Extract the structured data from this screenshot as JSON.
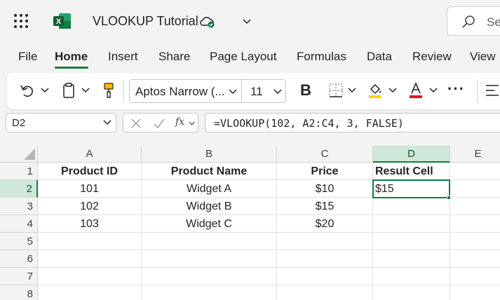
{
  "app": {
    "doc_title": "VLOOKUP Tutorial",
    "search_placeholder": "Sea",
    "logo_letter": "X"
  },
  "ribbon": {
    "tabs": [
      "File",
      "Home",
      "Insert",
      "Share",
      "Page Layout",
      "Formulas",
      "Data",
      "Review",
      "View"
    ],
    "active_tab": "Home"
  },
  "toolbar": {
    "font_name": "Aptos Narrow (...",
    "font_size": "11",
    "bold_label": "B",
    "more_label": "···",
    "font_color": "#e81123",
    "highlight_color": "#ffd400"
  },
  "formula_bar": {
    "name_box": "D2",
    "fx_label": "fx",
    "formula": "=VLOOKUP(102, A2:C4, 3, FALSE)"
  },
  "sheet": {
    "columns": [
      "A",
      "B",
      "C",
      "D",
      "E"
    ],
    "rows": [
      "1",
      "2",
      "3",
      "4",
      "5",
      "6",
      "7",
      "8"
    ],
    "selected_column": "D",
    "selected_row": "2",
    "cells": [
      [
        "Product ID",
        "Product Name",
        "Price",
        "Result Cell",
        ""
      ],
      [
        "101",
        "Widget A",
        "$10",
        "$15",
        ""
      ],
      [
        "102",
        "Widget B",
        "$15",
        "",
        ""
      ],
      [
        "103",
        "Widget C",
        "$20",
        "",
        ""
      ],
      [
        "",
        "",
        "",
        "",
        ""
      ],
      [
        "",
        "",
        "",
        "",
        ""
      ],
      [
        "",
        "",
        "",
        "",
        ""
      ],
      [
        "",
        "",
        "",
        "",
        ""
      ]
    ]
  },
  "colors": {
    "accent": "#107c41",
    "selected_header": "#cfe8d9"
  }
}
